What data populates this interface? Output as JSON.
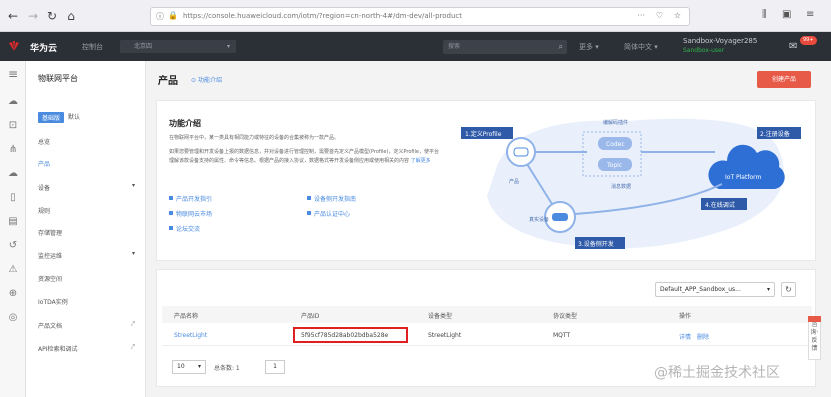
{
  "browser": {
    "url": "https://console.huaweicloud.com/iotm/?region=cn-north-4#/dm-dev/all-product"
  },
  "header": {
    "brand": "华为云",
    "console": "控制台",
    "region": "北京四",
    "search_placeholder": "搜索",
    "more": "更多",
    "language": "简体中文",
    "user": "Sandbox-Voyager285",
    "user_status": "Sandbox-user",
    "mail_count": "99+"
  },
  "sidebar": {
    "title": "物联网平台",
    "tag_active": "基础版",
    "tag": "默认",
    "items": [
      {
        "label": "总览"
      },
      {
        "label": "产品"
      },
      {
        "label": "设备"
      },
      {
        "label": "规则"
      },
      {
        "label": "存储管理"
      },
      {
        "label": "监控运维"
      },
      {
        "label": "资源空间"
      },
      {
        "label": "IoTDA实例"
      },
      {
        "label": "产品文档"
      },
      {
        "label": "API检索和调试"
      }
    ]
  },
  "main": {
    "title": "产品",
    "feature_link": "功能介绍",
    "create_button": "创建产品",
    "intro": {
      "title": "功能介绍",
      "para1": "在物联网平台中，某一类具有相同能力或特征的设备的合集被称为一款产品。",
      "para2": "如果您要管理和开发设备上报的数据信息，并对设备进行管理控制，需要首先定义产品模型(Profile)，定义Profile，使平台理解该款设备支持的属性、命令等信息。根据产品的接入协议，数据格式等开发设备侧应用或使用相关的内容",
      "more": "了解更多",
      "links": [
        "产品开发指引",
        "物联网云市场",
        "论坛交流",
        "设备侧开发指南",
        "产品认证中心"
      ]
    },
    "diagram": {
      "step1": "1.定义Profile",
      "step2": "2.注册设备",
      "step3": "3.设备侧开发",
      "step4": "4.在线调试",
      "codec": "编解码插件",
      "codec_box": "Codec",
      "topic_box": "Topic",
      "product": "产品",
      "platform": "IoT Platform",
      "message": "消息数据",
      "real_device": "真实设备"
    },
    "table": {
      "app_select": "Default_APP_Sandbox_us...",
      "columns": [
        "产品名称",
        "产品ID",
        "设备类型",
        "协议类型",
        "操作"
      ],
      "rows": [
        {
          "name": "StreetLight",
          "id": "5f95cf785d28ab02bdba528e",
          "type": "StreetLight",
          "protocol": "MQTT",
          "op1": "详情",
          "op2": "删除"
        }
      ],
      "page_size": "10",
      "total": "总条数: 1",
      "page": "1"
    },
    "side_tab": "咨询·反馈",
    "watermark": "@稀土掘金技术社区"
  }
}
